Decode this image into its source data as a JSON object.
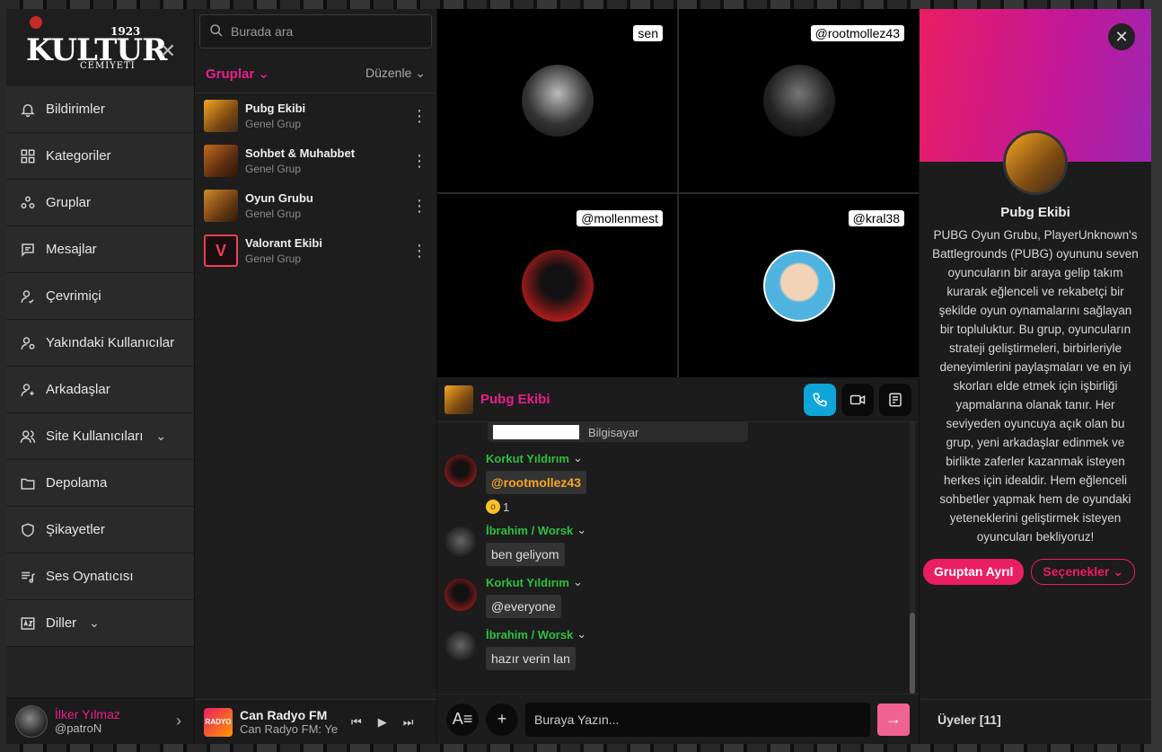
{
  "brand": {
    "year": "1923",
    "name": "KULTUR",
    "subtitle": "CEMIYETI"
  },
  "sidebar": {
    "items": [
      {
        "label": "Bildirimler",
        "icon": "bell-icon"
      },
      {
        "label": "Kategoriler",
        "icon": "grid-icon"
      },
      {
        "label": "Gruplar",
        "icon": "groups-icon"
      },
      {
        "label": "Mesajlar",
        "icon": "message-icon"
      },
      {
        "label": "Çevrimiçi",
        "icon": "online-user-icon"
      },
      {
        "label": "Yakındaki Kullanıcılar",
        "icon": "nearby-user-icon"
      },
      {
        "label": "Arkadaşlar",
        "icon": "add-friend-icon"
      },
      {
        "label": "Site Kullanıcıları",
        "icon": "users-icon"
      },
      {
        "label": "Depolama",
        "icon": "folder-icon"
      },
      {
        "label": "Şikayetler",
        "icon": "shield-icon"
      },
      {
        "label": "Ses Oynatıcısı",
        "icon": "music-list-icon"
      },
      {
        "label": "Diller",
        "icon": "language-icon"
      }
    ]
  },
  "profile": {
    "name": "İlker Yılmaz",
    "handle": "@patroN"
  },
  "groups": {
    "search_placeholder": "Burada ara",
    "header_left": "Gruplar",
    "header_right": "Düzenle",
    "items": [
      {
        "name": "Pubg Ekibi",
        "sub": "Genel Grup"
      },
      {
        "name": "Sohbet & Muhabbet",
        "sub": "Genel Grup"
      },
      {
        "name": "Oyun Grubu",
        "sub": "Genel Grup"
      },
      {
        "name": "Valorant Ekibi",
        "sub": "Genel Grup"
      }
    ]
  },
  "radio": {
    "logo": "RADYO",
    "title": "Can Radyo FM",
    "subtitle": "Can Radyo FM: Ye"
  },
  "video": {
    "tiles": [
      {
        "tag": "sen"
      },
      {
        "tag": "@rootmollez43"
      },
      {
        "tag": "@mollenmest"
      },
      {
        "tag": "@kral38"
      }
    ]
  },
  "chat": {
    "title": "Pubg Ekibi",
    "cut_text": "Bilgisayar",
    "messages": [
      {
        "author": "Korkut Yıldırım",
        "text": "@rootmollez43",
        "reaction_count": "1"
      },
      {
        "author": "İbrahim / Worsk",
        "text": "ben geliyom"
      },
      {
        "author": "Korkut Yıldırım",
        "text": "@everyone"
      },
      {
        "author": "İbrahim / Worsk",
        "text": "hazır verin lan"
      }
    ],
    "composer_placeholder": "Buraya Yazın..."
  },
  "info": {
    "title": "Pubg Ekibi",
    "description": "PUBG Oyun Grubu, PlayerUnknown's Battlegrounds (PUBG) oyununu seven oyuncuların bir araya gelip takım kurarak eğlenceli ve rekabetçi bir şekilde oyun oynamalarını sağlayan bir topluluktur. Bu grup, oyuncuların strateji geliştirmeleri, birbirleriyle deneyimlerini paylaşmaları ve en iyi skorları elde etmek için işbirliği yapmalarına olanak tanır. Her seviyeden oyuncuya açık olan bu grup, yeni arkadaşlar edinmek ve birlikte zaferler kazanmak isteyen herkes için idealdir. Hem eğlenceli sohbetler yapmak hem de oyundaki yeteneklerini geliştirmek isteyen oyuncuları bekliyoruz!",
    "leave_label": "Gruptan Ayrıl",
    "options_label": "Seçenekler",
    "members_label": "Üyeler [11]"
  },
  "colors": {
    "accent": "#e91e8c",
    "online_green": "#2fbf3f",
    "call_blue": "#0ea5d9"
  }
}
